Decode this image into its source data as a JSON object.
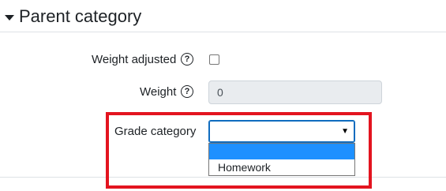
{
  "section": {
    "title": "Parent category"
  },
  "fields": {
    "weight_adjusted": {
      "label": "Weight adjusted",
      "help_icon": "question-circle-icon",
      "checked": false
    },
    "weight": {
      "label": "Weight",
      "help_icon": "question-circle-icon",
      "value": "0"
    },
    "grade_category": {
      "label": "Grade category",
      "selected_value": "",
      "dropdown_arrow": "▼",
      "options": [
        "",
        "Homework"
      ]
    }
  },
  "colors": {
    "highlight": "#e3141f",
    "selected_option": "#1e90ff",
    "focus_border": "#0f6cbf"
  }
}
